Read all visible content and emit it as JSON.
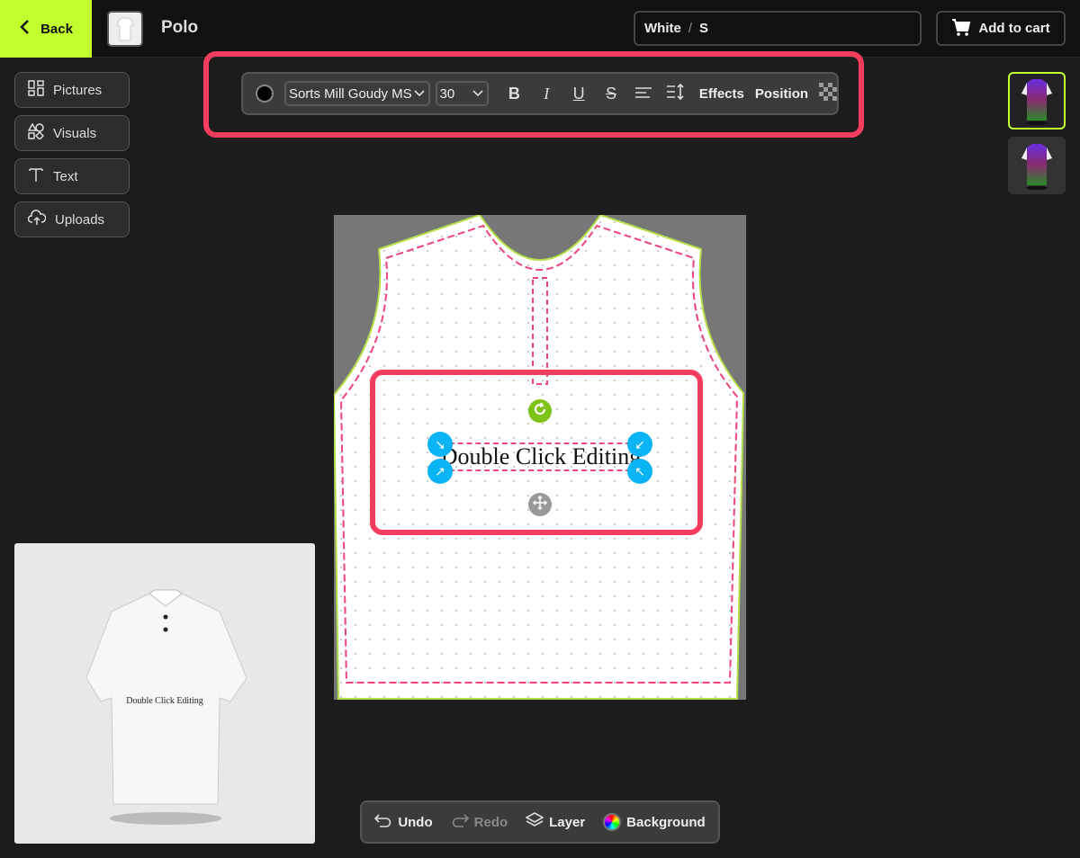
{
  "header": {
    "back_label": "Back",
    "product_title": "Polo",
    "variant": {
      "color": "White",
      "separator": "/",
      "size": "S"
    },
    "add_to_cart_label": "Add to cart"
  },
  "sidebar": {
    "items": [
      {
        "label": "Pictures",
        "icon": "grid-icon"
      },
      {
        "label": "Visuals",
        "icon": "shapes-icon"
      },
      {
        "label": "Text",
        "icon": "text-icon"
      },
      {
        "label": "Uploads",
        "icon": "cloud-upload-icon"
      }
    ]
  },
  "toolbar": {
    "text_color": "#000000",
    "font": "Sorts Mill Goudy MS",
    "font_size": "30",
    "bold": "B",
    "italic": "I",
    "underline": "U",
    "strike": "S",
    "effects_label": "Effects",
    "position_label": "Position"
  },
  "canvas": {
    "text": "Double Click Editing"
  },
  "preview": {
    "text": "Double Click Editing"
  },
  "bottombar": {
    "undo": "Undo",
    "redo": "Redo",
    "layer": "Layer",
    "background": "Background"
  },
  "colors": {
    "accent": "#c2ff2e",
    "highlight": "#f23d5e",
    "handle": "#0bb4f5",
    "rotate": "#7ec21a"
  }
}
